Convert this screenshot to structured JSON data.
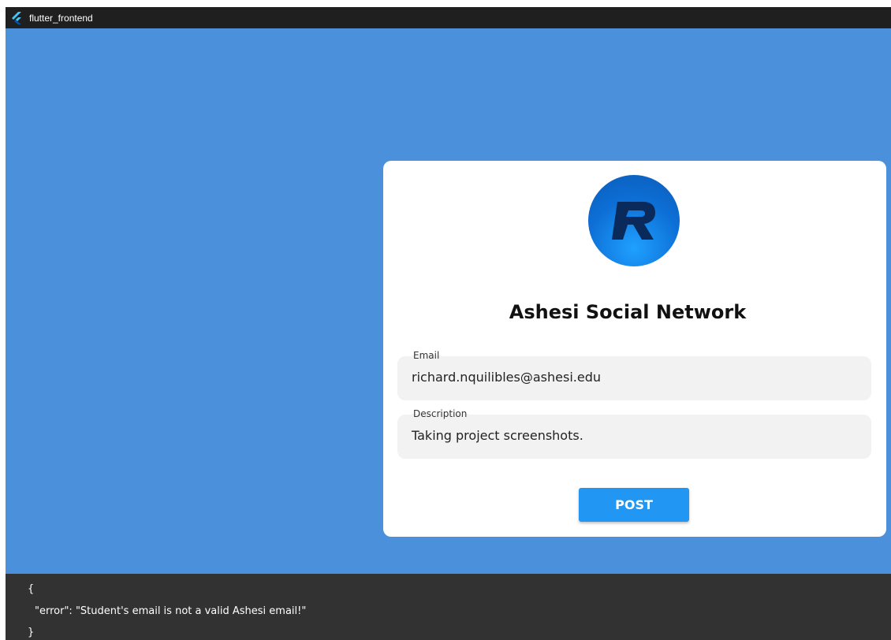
{
  "window": {
    "title": "flutter_frontend",
    "icon": "flutter-icon",
    "titlebar_color": "#1f1f1f"
  },
  "main": {
    "background_color": "#4a90da",
    "card": {
      "logo": "r-logo-icon",
      "app_name": "Ashesi Social Network",
      "email_field": {
        "label": "Email",
        "value": "richard.nquilibles@ashesi.edu"
      },
      "description_field": {
        "label": "Description",
        "value": "Taking project screenshots."
      },
      "post_button_label": "POST",
      "accent_color": "#2196f3"
    }
  },
  "console": {
    "lines": [
      "{",
      "\"error\": \"Student's email is not a valid Ashesi email!\"",
      "}"
    ]
  }
}
